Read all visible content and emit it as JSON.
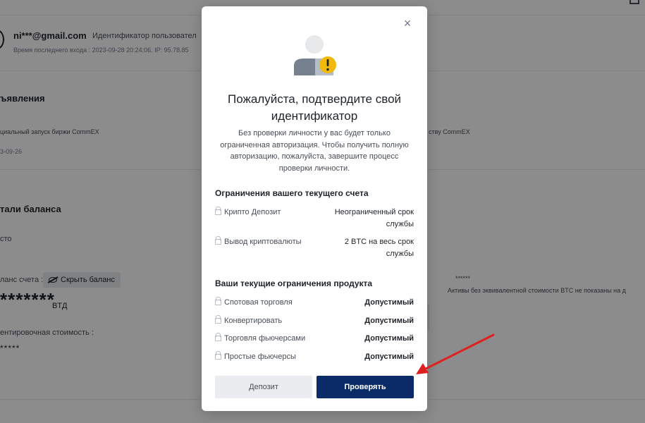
{
  "background": {
    "email": "ni***@gmail.com",
    "uid_label": "Идентификатор пользовател",
    "last_login": "Время последнего входа : 2023-09-28 20:24:06.  IP: 95.78.85",
    "announcements_title": "ъявления",
    "announcement_left": "циальный запуск биржи CommEX",
    "announcement_date": "3-09-26",
    "announcement_right": "ству CommEX",
    "balance_title": "тали баланса",
    "balance_sub": "сто",
    "balance_label": "ланс счета :",
    "hide_balance_label": "Скрыть баланс",
    "balance_value": "*******",
    "balance_unit": "BTД",
    "estimated_label": "ентировочная стоимость :",
    "estimated_value": "*****",
    "right_stars": "******",
    "right_note": "Активы без эквивалентной стоимости BTC не показаны на д"
  },
  "modal": {
    "close_glyph": "×",
    "title": "Пожалуйста, подтвердите свой идентификатор",
    "description": "Без проверки личности у вас будет только ограниченная авторизация. Чтобы получить полную авторизацию, пожалуйста, завершите процесс проверки личности.",
    "account_limits_title": "Ограничения вашего текущего счета",
    "account_limits": [
      {
        "label": "Крипто Депозит",
        "value": "Неограниченный срок службы"
      },
      {
        "label": "Вывод криптовалюты",
        "value": "2 BTC на весь срок службы"
      }
    ],
    "product_limits_title": "Ваши текущие ограничения продукта",
    "product_limits": [
      {
        "label": "Спотовая торговля",
        "value": "Допустимый"
      },
      {
        "label": "Конвертировать",
        "value": "Допустимый"
      },
      {
        "label": "Торговля фьючерсами",
        "value": "Допустимый"
      },
      {
        "label": "Простые фьючерсы",
        "value": "Допустимый"
      }
    ],
    "deposit_button": "Депозит",
    "verify_button": "Проверять"
  },
  "colors": {
    "primary_button": "#0b2a68",
    "warning": "#f0b90b",
    "annotation_arrow": "#e02020"
  },
  "icons": {
    "user_warning": "user-warning-icon",
    "lock": "lock-icon",
    "close": "close-icon",
    "eye_off": "eye-off-icon"
  }
}
